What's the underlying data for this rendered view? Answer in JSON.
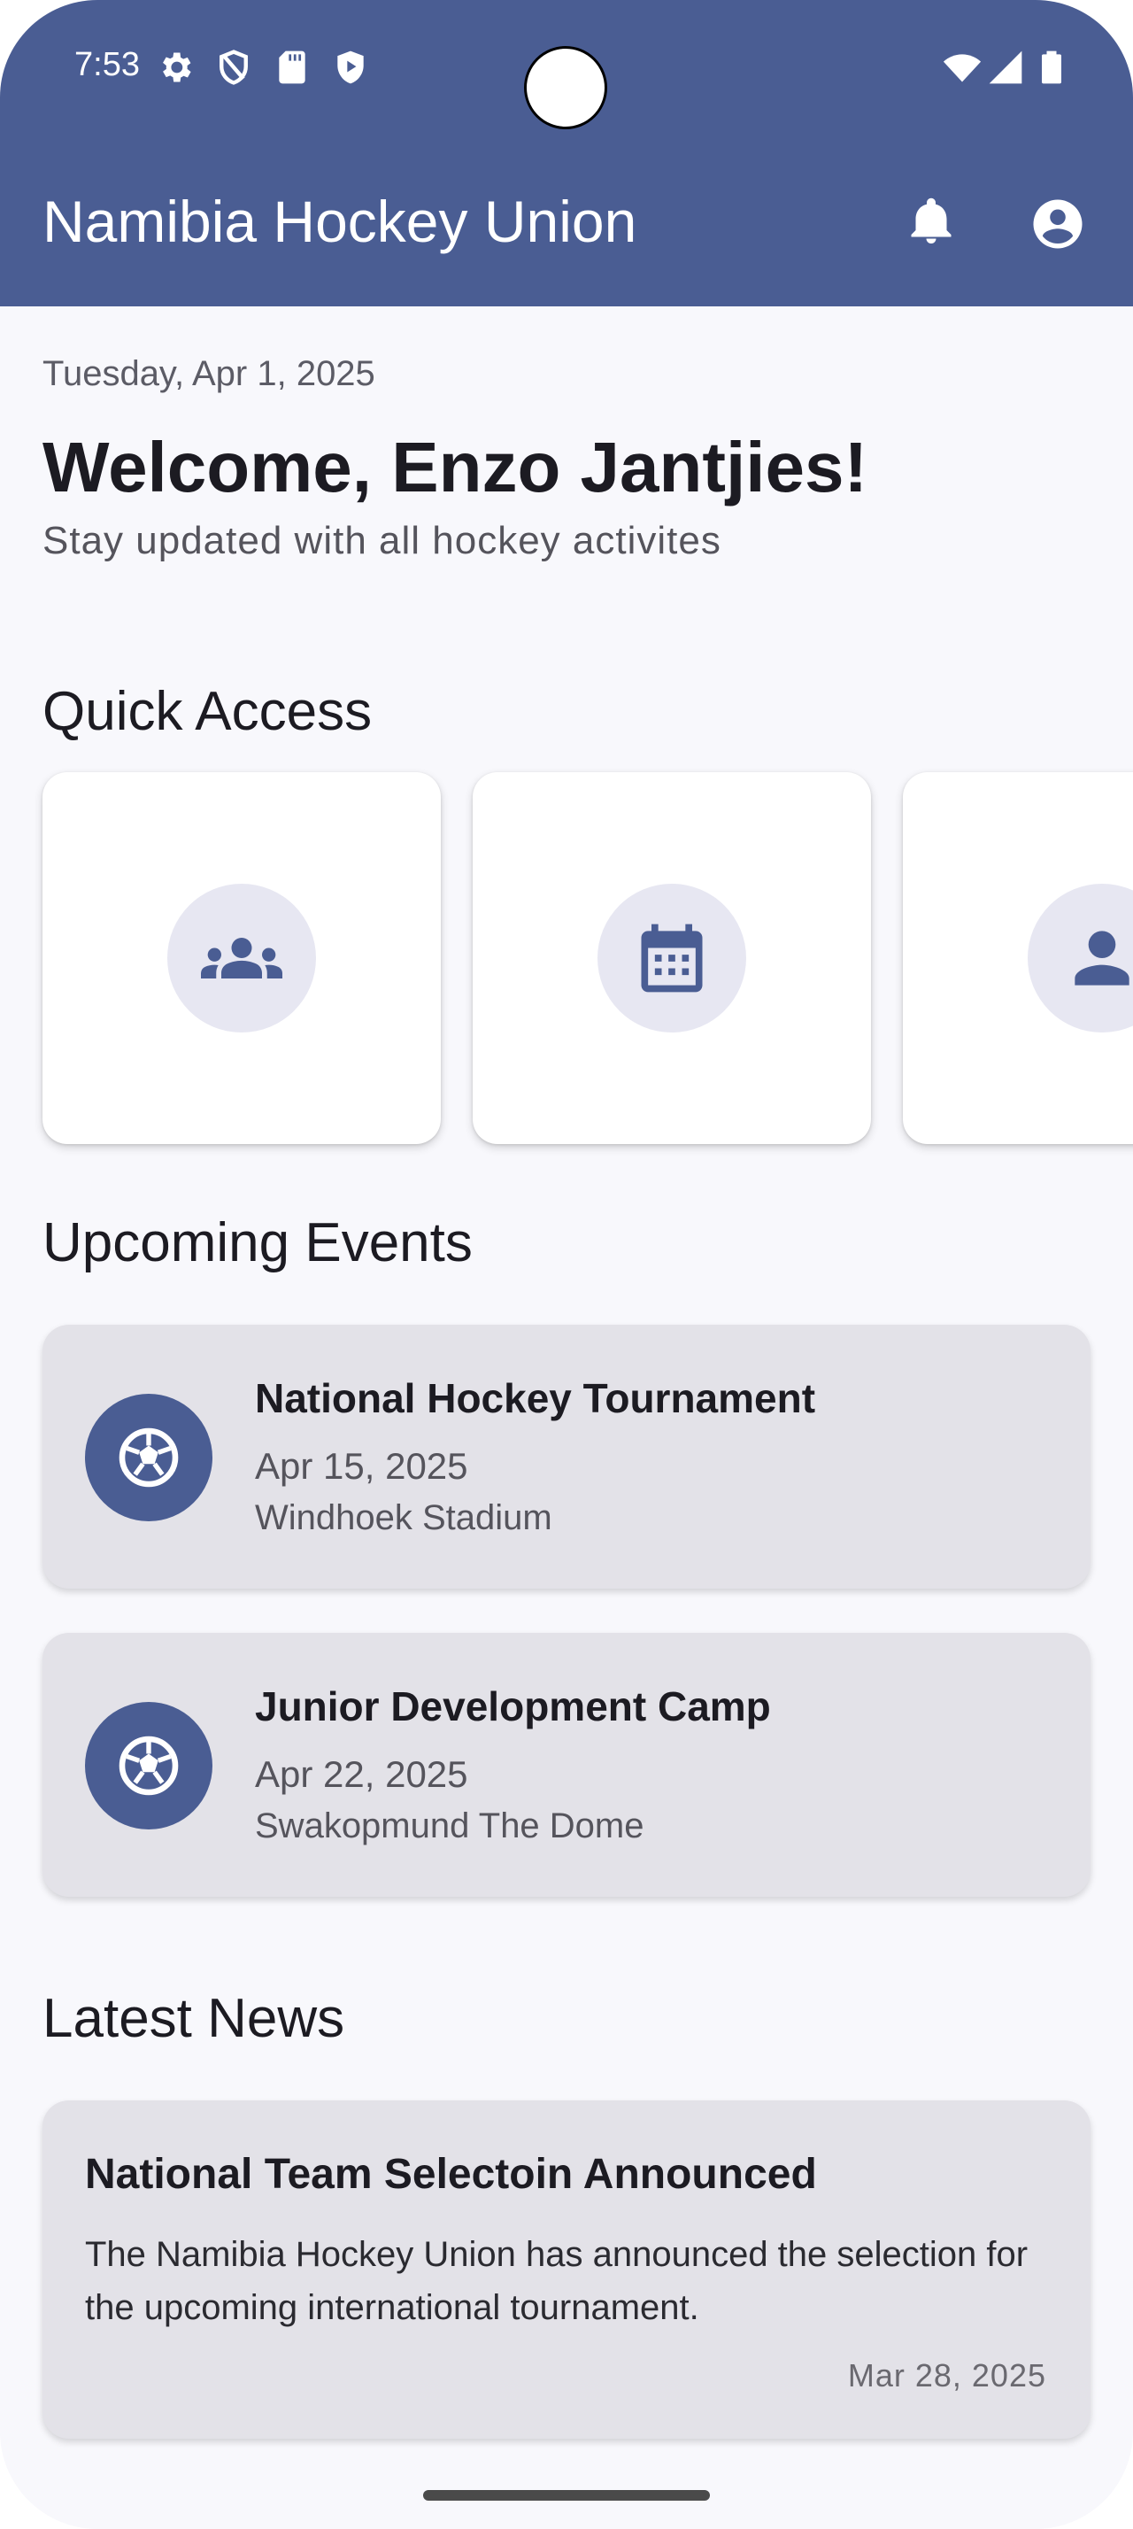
{
  "status_bar": {
    "time": "7:53",
    "left_icons": [
      "gear-icon",
      "shield-icon",
      "sd-card-icon",
      "play-shield-icon"
    ],
    "right_icons": [
      "wifi-icon",
      "signal-icon",
      "battery-icon"
    ]
  },
  "app_bar": {
    "title": "Namibia Hockey Union",
    "actions": [
      "bell-icon",
      "account-circle-icon"
    ]
  },
  "header": {
    "date": "Tuesday, Apr 1, 2025",
    "welcome": "Welcome, Enzo Jantjies!",
    "subtitle": "Stay updated with all hockey activites"
  },
  "quick_access": {
    "title": "Quick Access",
    "items": [
      {
        "icon": "groups-icon"
      },
      {
        "icon": "calendar-icon"
      },
      {
        "icon": "person-icon"
      }
    ]
  },
  "events": {
    "title": "Upcoming Events",
    "items": [
      {
        "icon": "ball-icon",
        "title": "National Hockey Tournament",
        "date": "Apr 15, 2025",
        "venue": "Windhoek Stadium"
      },
      {
        "icon": "ball-icon",
        "title": "Junior Development Camp",
        "date": "Apr 22, 2025",
        "venue": "Swakopmund The Dome"
      }
    ]
  },
  "news": {
    "title": "Latest News",
    "items": [
      {
        "title": "National Team Selectoin Announced",
        "body": "The Namibia Hockey Union has announced the selection for the upcoming international tournament.",
        "date": "Mar 28, 2025"
      }
    ]
  },
  "colors": {
    "primary": "#4a5d93",
    "background": "#f8f8fc",
    "card": "#e3e2e8",
    "icon_circle": "#e7e7f2"
  }
}
